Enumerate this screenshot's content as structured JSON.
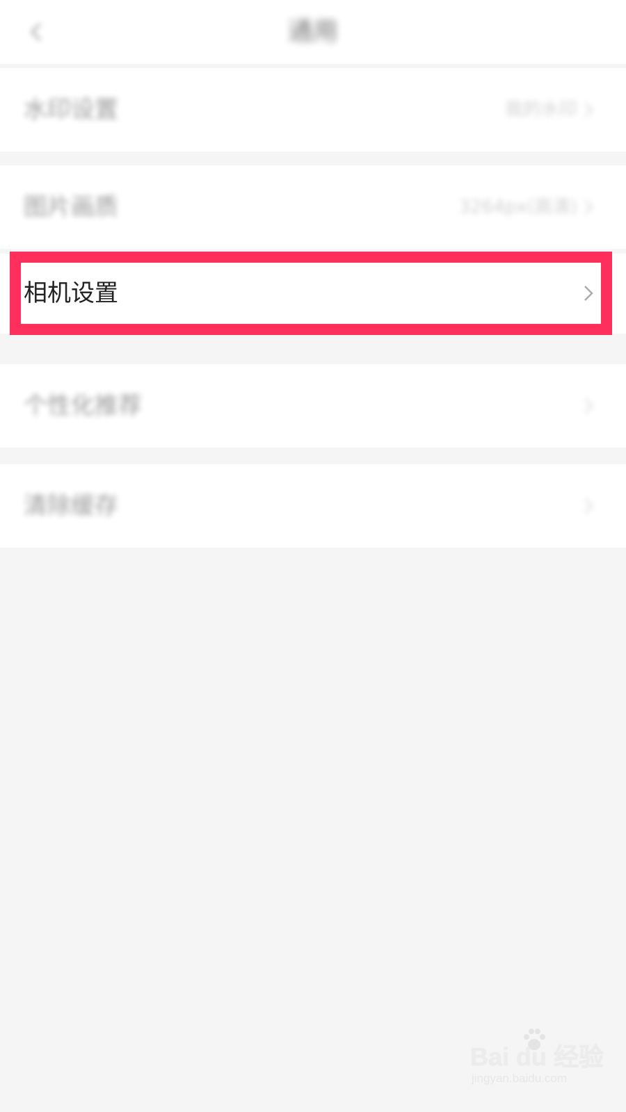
{
  "header": {
    "title": "通用",
    "back_icon": "chevron-left-icon"
  },
  "settings": {
    "items": [
      {
        "label": "水印设置",
        "value": "我的水印",
        "icon": "chevron-right-icon"
      },
      {
        "label": "图片画质",
        "value": "3264px(高清)",
        "icon": "chevron-right-icon"
      },
      {
        "label": "相机设置",
        "value": "",
        "icon": "chevron-right-icon",
        "highlighted": true
      },
      {
        "label": "个性化推荐",
        "value": "",
        "icon": "chevron-right-icon"
      },
      {
        "label": "清除缓存",
        "value": "",
        "icon": "chevron-right-icon"
      }
    ]
  },
  "highlight": {
    "color": "#fe2f5d"
  },
  "watermark": {
    "brand": "Bai du 经验",
    "url": "jingyan.baidu.com",
    "icon": "baidu-paw-icon"
  }
}
